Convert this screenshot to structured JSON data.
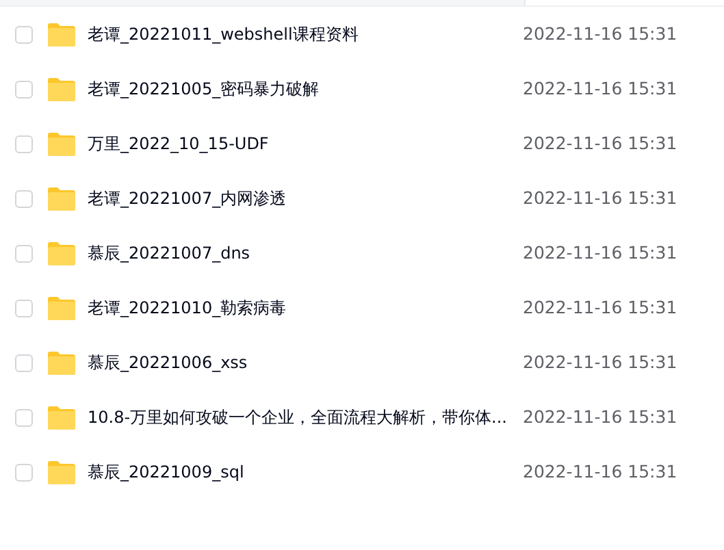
{
  "files": [
    {
      "name": "老谭_20221011_webshell课程资料",
      "modified": "2022-11-16 15:31",
      "checked": false
    },
    {
      "name": "老谭_20221005_密码暴力破解",
      "modified": "2022-11-16 15:31",
      "checked": false
    },
    {
      "name": "万里_2022_10_15-UDF",
      "modified": "2022-11-16 15:31",
      "checked": false
    },
    {
      "name": "老谭_20221007_内网渗透",
      "modified": "2022-11-16 15:31",
      "checked": false
    },
    {
      "name": "慕辰_20221007_dns",
      "modified": "2022-11-16 15:31",
      "checked": false
    },
    {
      "name": "老谭_20221010_勒索病毒",
      "modified": "2022-11-16 15:31",
      "checked": false
    },
    {
      "name": "慕辰_20221006_xss",
      "modified": "2022-11-16 15:31",
      "checked": false
    },
    {
      "name": "10.8-万里如何攻破一个企业，全面流程大解析，带你体...",
      "modified": "2022-11-16 15:31",
      "checked": false
    },
    {
      "name": "慕辰_20221009_sql",
      "modified": "2022-11-16 15:31",
      "checked": false
    }
  ]
}
